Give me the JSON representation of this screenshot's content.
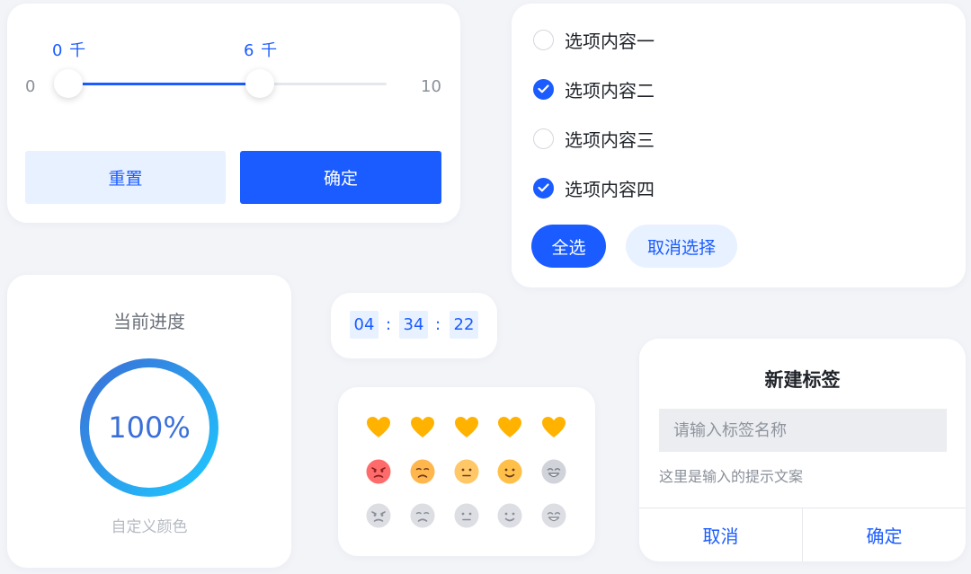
{
  "colors": {
    "brand": "#1a5cff",
    "brand_light": "#e8f1ff",
    "heart": "#ffb300"
  },
  "slider": {
    "min_label": "0",
    "max_label": "10",
    "range_min": 0,
    "range_max": 10,
    "low_value": 0,
    "high_value": 6,
    "low_bubble": "0 千",
    "high_bubble": "6 千",
    "reset_label": "重置",
    "confirm_label": "确定"
  },
  "checkbox_group": {
    "options": [
      {
        "label": "选项内容一",
        "checked": false
      },
      {
        "label": "选项内容二",
        "checked": true
      },
      {
        "label": "选项内容三",
        "checked": false
      },
      {
        "label": "选项内容四",
        "checked": true
      }
    ],
    "select_all_label": "全选",
    "deselect_label": "取消选择"
  },
  "progress": {
    "title": "当前进度",
    "value_text": "100%",
    "percent": 100,
    "caption": "自定义颜色",
    "gradient_start": "#1fc8ff",
    "gradient_end": "#3a6fd8"
  },
  "timer": {
    "hours": "04",
    "minutes": "34",
    "seconds": "22",
    "separator": ":"
  },
  "rating": {
    "hearts": {
      "count": 5,
      "filled": 5,
      "icon": "heart-icon"
    },
    "colored_faces": [
      "angry-face-icon",
      "sad-face-icon",
      "neutral-face-icon",
      "smile-face-icon",
      "grin-face-icon"
    ],
    "colored_face_selected_index": 3,
    "gray_faces": [
      "angry-face-icon",
      "sad-face-icon",
      "neutral-face-icon",
      "smile-face-icon",
      "grin-face-icon"
    ]
  },
  "dialog": {
    "title": "新建标签",
    "input_placeholder": "请输入标签名称",
    "input_value": "",
    "tip": "这里是输入的提示文案",
    "cancel_label": "取消",
    "confirm_label": "确定"
  }
}
